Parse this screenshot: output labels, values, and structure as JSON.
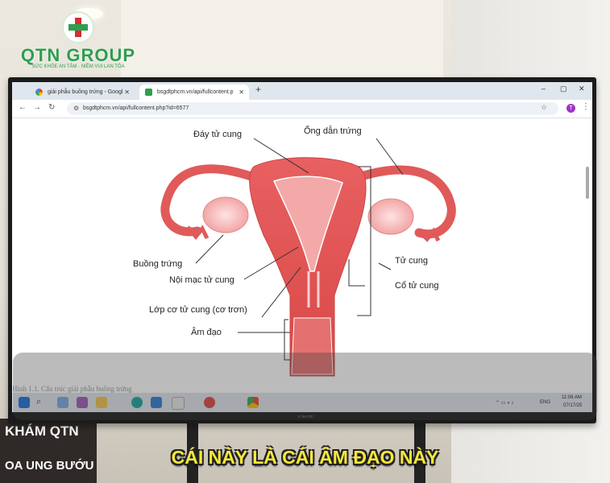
{
  "logo": {
    "name": "QTN GROUP",
    "tagline": "SỨC KHỎE AN TÂM · NIỀM VUI LAN TỎA"
  },
  "banner": {
    "line1": "KHÁM QTN",
    "line2": "OA UNG BƯỚU"
  },
  "monitor": {
    "brand": "xiaomi"
  },
  "browser": {
    "tabs": [
      {
        "label": "giải phẫu buồng trứng - Googl",
        "icon": "google-icon",
        "active": false
      },
      {
        "label": "bsgdtphcm.vn/api/fullcontent.p",
        "icon": "site-icon",
        "active": true
      }
    ],
    "new_tab": "+",
    "url": "bsgdtphcm.vn/api/fullcontent.php?id=6577",
    "profile_initial": "T",
    "window_controls": {
      "minimize": "–",
      "maximize": "▢",
      "close": "✕"
    }
  },
  "diagram": {
    "labels": {
      "fundus": "Đáy tử cung",
      "tube": "Ống dẫn trứng",
      "ovary": "Buồng trứng",
      "uterus": "Tử cung",
      "endometrium": "Nội mạc tử cung",
      "cervix": "Cổ tử cung",
      "myometrium": "Lớp cơ tử cung (cơ trơn)",
      "vagina": "Âm đạo"
    },
    "caption": "Hình 1.1. Cấu trúc giải phẫu buồng trứng"
  },
  "taskbar": {
    "time": "11:06 AM",
    "date": "07/17/25",
    "lang": "ENG"
  },
  "subtitle": "CÁI NÀY LÀ CÁI ÂM ĐẠO NÀY",
  "colors": {
    "accent": "#2e9e4f",
    "subtitle": "#f6e83a",
    "uterus": "#e05a5a"
  }
}
